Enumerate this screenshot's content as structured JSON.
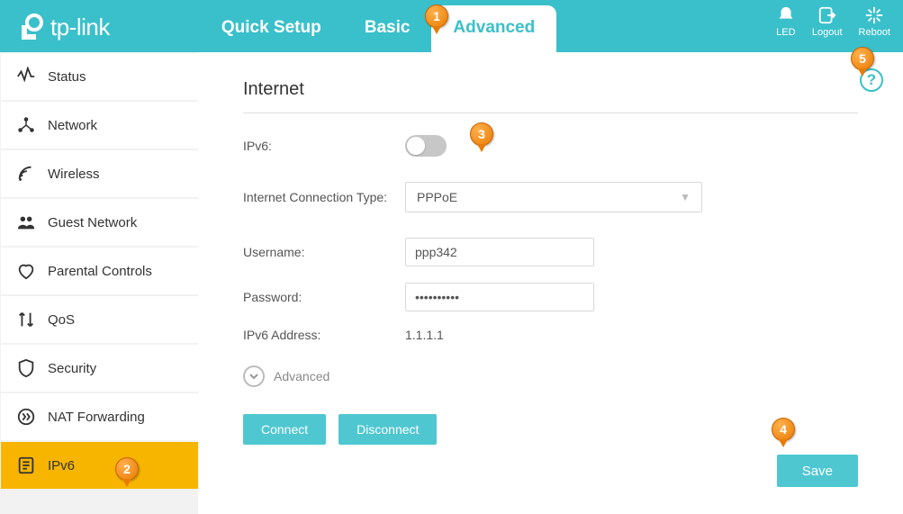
{
  "brand": "tp-link",
  "header": {
    "tabs": [
      {
        "label": "Quick Setup"
      },
      {
        "label": "Basic"
      },
      {
        "label": "Advanced"
      }
    ],
    "actions": {
      "led": "LED",
      "logout": "Logout",
      "reboot": "Reboot"
    }
  },
  "sidebar": {
    "items": [
      {
        "label": "Status"
      },
      {
        "label": "Network"
      },
      {
        "label": "Wireless"
      },
      {
        "label": "Guest Network"
      },
      {
        "label": "Parental Controls"
      },
      {
        "label": "QoS"
      },
      {
        "label": "Security"
      },
      {
        "label": "NAT Forwarding"
      },
      {
        "label": "IPv6"
      }
    ]
  },
  "page": {
    "title": "Internet",
    "labels": {
      "ipv6": "IPv6:",
      "conn_type": "Internet Connection Type:",
      "username": "Username:",
      "password": "Password:",
      "ipv6_addr": "IPv6 Address:",
      "advanced": "Advanced"
    },
    "values": {
      "conn_type": "PPPoE",
      "username": "ppp342",
      "password": "••••••••••",
      "ipv6_addr": "1.1.1.1"
    },
    "buttons": {
      "connect": "Connect",
      "disconnect": "Disconnect",
      "save": "Save"
    },
    "help": "?"
  },
  "callouts": {
    "c1": "1",
    "c2": "2",
    "c3": "3",
    "c4": "4",
    "c5": "5"
  }
}
